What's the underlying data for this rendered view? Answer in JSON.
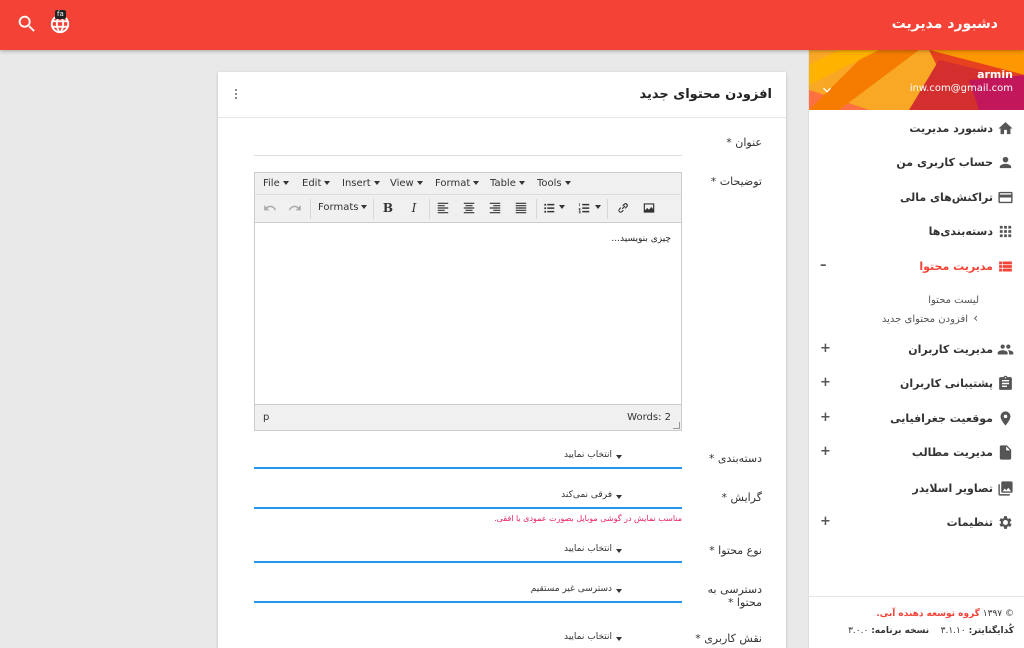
{
  "header": {
    "brand": "دشبورد مدیریت",
    "lang_badge": "fa",
    "icons": [
      "globe-icon",
      "search-icon"
    ]
  },
  "user": {
    "name": "armin",
    "email": "inw.com@gmail.com"
  },
  "sidebar": {
    "items": [
      {
        "label": "دشبورد مدیریت",
        "icon": "home-icon",
        "toggle": ""
      },
      {
        "label": "حساب کاربری من",
        "icon": "person-icon",
        "toggle": ""
      },
      {
        "label": "تراکنش‌های مالی",
        "icon": "credit-card-icon",
        "toggle": ""
      },
      {
        "label": "دسته‌بندی‌ها",
        "icon": "apps-icon",
        "toggle": ""
      },
      {
        "label": "مدیریت محتوا",
        "icon": "view-list-icon",
        "toggle": "–"
      },
      {
        "label": "مدیریت کاربران",
        "icon": "people-icon",
        "toggle": "+"
      },
      {
        "label": "پشتیبانی کاربران",
        "icon": "assignment-icon",
        "toggle": "+"
      },
      {
        "label": "موقعیت جغرافیایی",
        "icon": "place-icon",
        "toggle": "+"
      },
      {
        "label": "مدیریت مطالب",
        "icon": "file-icon",
        "toggle": "+"
      },
      {
        "label": "تصاویر اسلایدر",
        "icon": "photo-icon",
        "toggle": ""
      },
      {
        "label": "تنظیمات",
        "icon": "settings-icon",
        "toggle": "+"
      }
    ],
    "sub_items": [
      {
        "label": "لیست محتوا"
      },
      {
        "label": "افزودن محتوای جدید",
        "marker": "›"
      }
    ],
    "footer": {
      "copyright": "© ۱۳۹۷",
      "company": "گروه توسعه دهنده آبی.",
      "version_label": "کُدایگنایتر:",
      "version_value": "۳.۱.۱۰",
      "app_version_label": "نسخه برنامه:",
      "app_version_value": "۳.۰.۰"
    }
  },
  "card": {
    "title": "افزودن محتوای جدید",
    "fields": {
      "title_label": "عنوان *",
      "desc_label": "توضیحات *",
      "category_label": "دسته‌بندی *",
      "orientation_label": "گرایش *",
      "type_label": "نوع محتوا *",
      "access_label_1": "دسترسی به",
      "access_label_2": "محتوا *",
      "role_label": "نقش کاربری *"
    },
    "selects": {
      "category": "انتخاب نمایید",
      "orientation": "فرقی نمی‌کند",
      "type": "انتخاب نمایید",
      "access": "دسترسی غیر مستقیم",
      "role": "انتخاب نمایید"
    },
    "hint": "مناسب نمایش در گوشی موبایل بصورت عمودی یا افقی."
  },
  "editor": {
    "menus": [
      "File",
      "Edit",
      "Insert",
      "View",
      "Format",
      "Table",
      "Tools"
    ],
    "formats_label": "Formats",
    "bold": "B",
    "italic": "I",
    "placeholder": "چیزی بنویسید...",
    "path": "p",
    "words": "Words: 2"
  }
}
